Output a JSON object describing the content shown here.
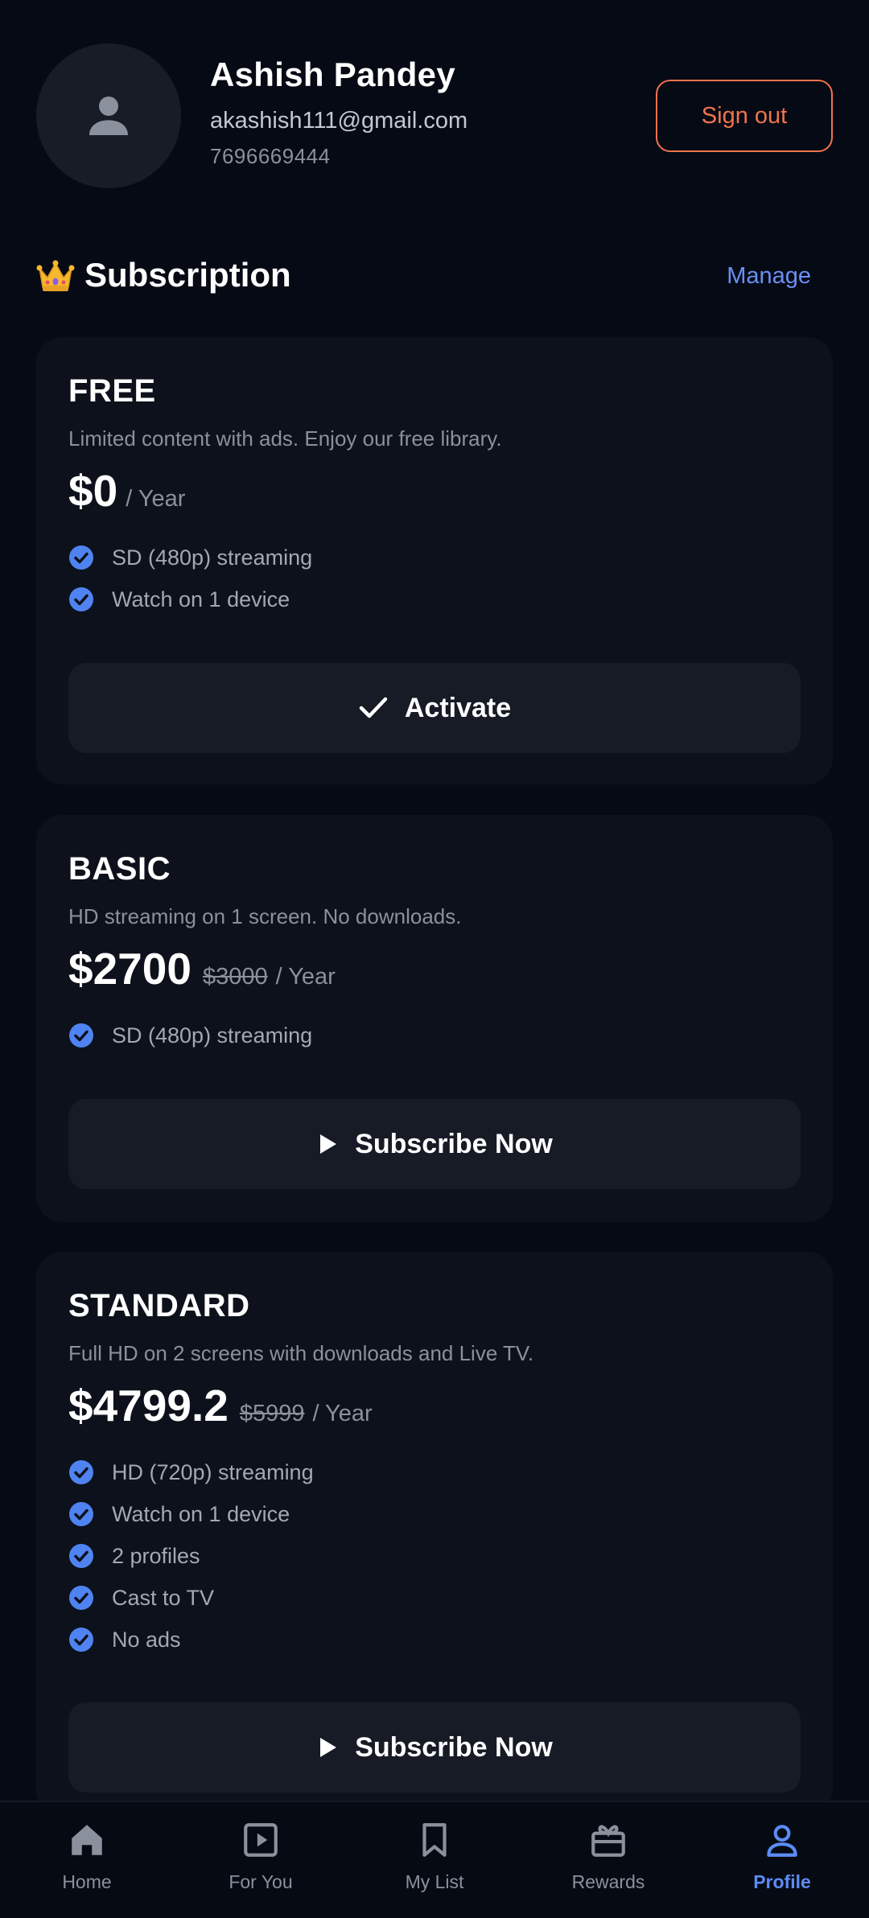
{
  "profile": {
    "name": "Ashish Pandey",
    "email": "akashish111@gmail.com",
    "phone": "7696669444",
    "sign_out_label": "Sign out",
    "avatar_icon": "person-icon"
  },
  "subscription": {
    "title": "Subscription",
    "title_icon": "crown-emoji",
    "manage_label": "Manage"
  },
  "plans": [
    {
      "name": "FREE",
      "description": "Limited content with ads. Enjoy our free library.",
      "price": "$0",
      "original_price": "",
      "period": "/ Year",
      "features": [
        "SD (480p) streaming",
        "Watch on 1 device"
      ],
      "cta_label": "Activate",
      "cta_icon": "checkmark-icon"
    },
    {
      "name": "BASIC",
      "description": "HD streaming on 1 screen. No downloads.",
      "price": "$2700",
      "original_price": "$3000",
      "period": "/ Year",
      "features": [
        "SD (480p) streaming"
      ],
      "cta_label": "Subscribe Now",
      "cta_icon": "play-icon"
    },
    {
      "name": "STANDARD",
      "description": "Full HD on 2 screens with downloads and Live TV.",
      "price": "$4799.2",
      "original_price": "$5999",
      "period": "/ Year",
      "features": [
        "HD (720p) streaming",
        "Watch on 1 device",
        "2 profiles",
        "Cast to TV",
        "No ads"
      ],
      "cta_label": "Subscribe Now",
      "cta_icon": "play-icon"
    }
  ],
  "nav": {
    "items": [
      {
        "label": "Home",
        "icon": "home-icon",
        "active": false
      },
      {
        "label": "For You",
        "icon": "play-square-icon",
        "active": false
      },
      {
        "label": "My List",
        "icon": "bookmark-icon",
        "active": false
      },
      {
        "label": "Rewards",
        "icon": "gift-icon",
        "active": false
      },
      {
        "label": "Profile",
        "icon": "person-icon",
        "active": true
      }
    ]
  },
  "colors": {
    "background": "#050a14",
    "card": "#0c111b",
    "accent_blue": "#5b8cf6",
    "sign_out_orange": "#f2734d"
  }
}
